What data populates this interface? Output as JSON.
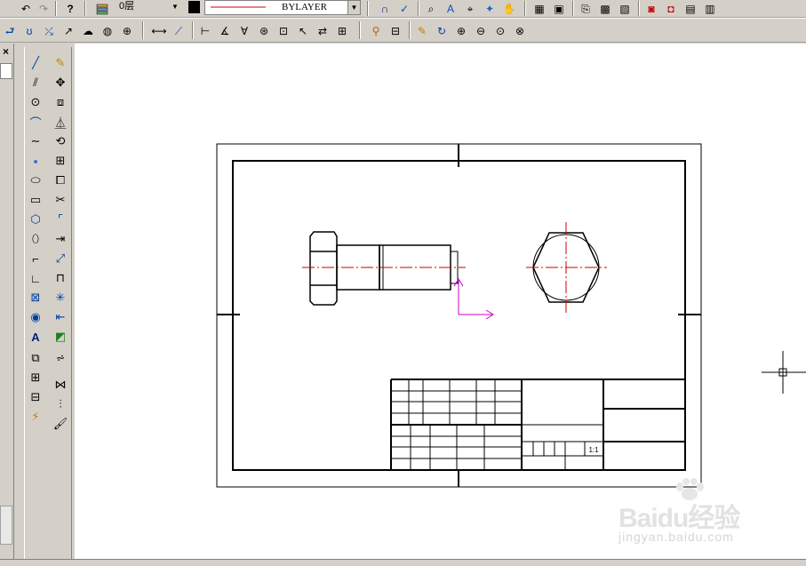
{
  "toolbar_row1": {
    "layer_name": "0层",
    "linetype_value": "BYLAYER",
    "colors": {
      "layer_swatch": "#000000",
      "linetype_line": "#cc0000"
    }
  },
  "toolbar_row2": {
    "icons": [
      "undo-icon",
      "redo-icon",
      "help-icon",
      "layers-icon",
      "snap-icon",
      "track-icon",
      "zoom-window-icon",
      "zoom-realtime-icon",
      "pan-icon",
      "properties-icon"
    ]
  },
  "left_panel": {
    "close_label": "×"
  },
  "drawing": {
    "scale_label": "1:1",
    "colors": {
      "outline": "#000000",
      "centerline": "#cc0000",
      "ucs": "#cc00cc",
      "cursor": "#000000"
    }
  },
  "watermark": {
    "brand": "Baidu经验",
    "url": "jingyan.baidu.com"
  }
}
